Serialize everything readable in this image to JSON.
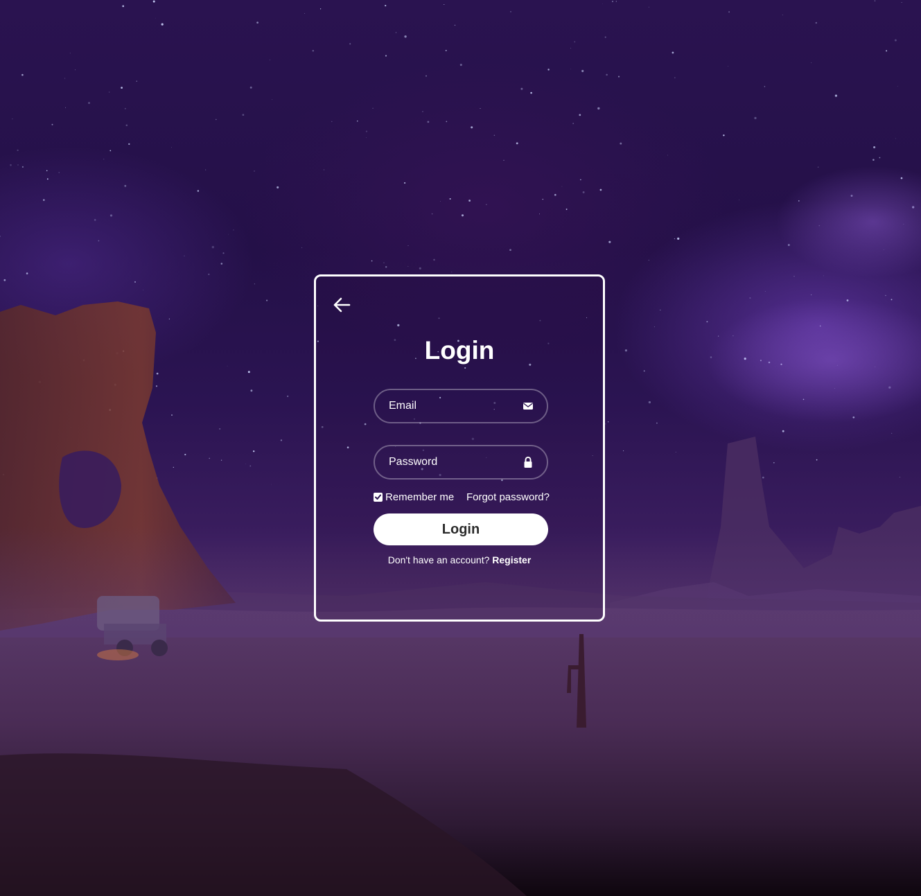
{
  "login_form": {
    "title": "Login",
    "back_icon": "arrow-left-icon",
    "email": {
      "placeholder": "Email",
      "value": "",
      "icon": "envelope-icon"
    },
    "password": {
      "placeholder": "Password",
      "value": "",
      "icon": "lock-icon"
    },
    "remember_me": {
      "label": "Remember me",
      "checked": true
    },
    "forgot_password_label": "Forgot password?",
    "submit_label": "Login",
    "register_prompt": "Don't have an account?",
    "register_link_label": "Register"
  },
  "colors": {
    "card_border": "#ffffff",
    "button_bg": "#ffffff",
    "button_text": "#2b2b2b",
    "text": "#ffffff",
    "sky_top": "#2a1350",
    "ground": "#4a2b5a"
  }
}
